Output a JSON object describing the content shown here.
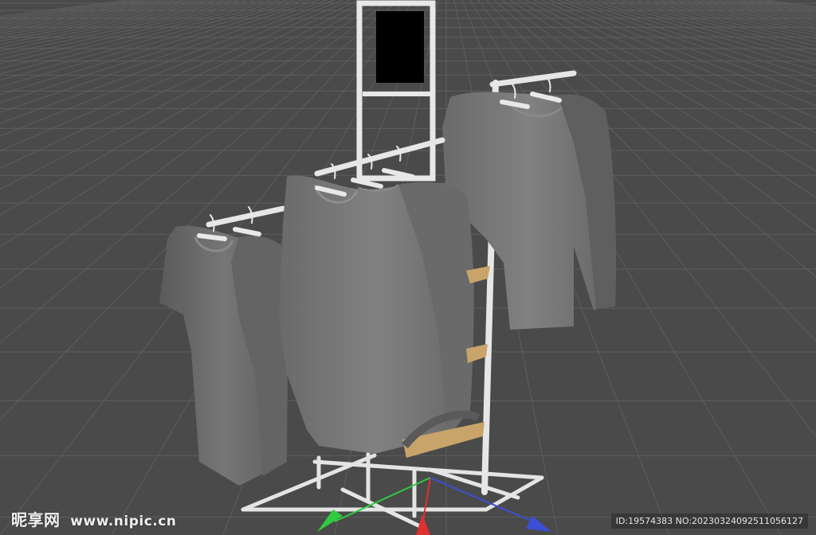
{
  "watermark": {
    "brand": "昵享网",
    "url": "www.nipic.cn",
    "id_text": "ID:19574383 NO:20230324092511056127"
  },
  "scene": {
    "background": "#4a4a4a",
    "grid_color": "#5c5c5c",
    "garment_color": "#6e6e6e",
    "rack_color": "#e8e8e8",
    "shelf_color": "#c8a46a",
    "sign_panel_color": "#000000",
    "axis_colors": {
      "x": "#3a4fd6",
      "y": "#2ecc40",
      "z": "#e03030"
    }
  }
}
